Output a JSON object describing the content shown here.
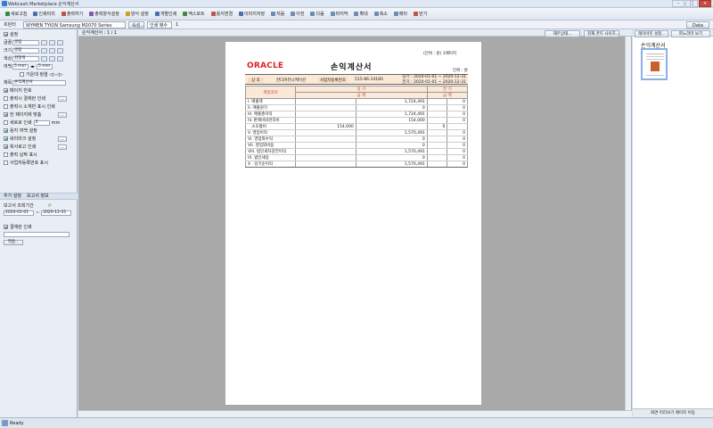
{
  "window": {
    "title": "Webcash Marketplace 손익계산서"
  },
  "menu": [
    {
      "label": "새로고침",
      "color": "#3a8e3a"
    },
    {
      "label": "인쇄미리",
      "color": "#4b6fb0"
    },
    {
      "label": "출력하기",
      "color": "#c0534a"
    },
    {
      "label": "출력양식설정",
      "color": "#7e5ab0"
    },
    {
      "label": "양식 설정",
      "color": "#d49a2a"
    },
    {
      "label": "개별인쇄",
      "color": "#4b6fb0"
    },
    {
      "label": "엑스포트",
      "color": "#3a8e3a"
    },
    {
      "label": "용지변경",
      "color": "#c0534a"
    },
    {
      "label": "이미지저장",
      "color": "#4b6fb0"
    },
    {
      "label": "처음",
      "color": "#6b8bb8"
    },
    {
      "label": "이전",
      "color": "#6b8bb8"
    },
    {
      "label": "다음",
      "color": "#6b8bb8"
    },
    {
      "label": "마지막",
      "color": "#6b8bb8"
    },
    {
      "label": "확대",
      "color": "#6b8bb8"
    },
    {
      "label": "축소",
      "color": "#6b8bb8"
    },
    {
      "label": "메타",
      "color": "#6b8bb8"
    },
    {
      "label": "닫기",
      "color": "#c0534a"
    }
  ],
  "toolbar": {
    "printer_label": "프린터",
    "printer_value": "WYMEN TYION Samsung M2070 Series",
    "btn_prop": "속성...",
    "print_options": "인쇄 매수",
    "copies": "1",
    "right_btn": "Data"
  },
  "left": {
    "section": "설정",
    "font_rows": [
      {
        "label": "글꼴",
        "value": "굴림"
      },
      {
        "label": "크기",
        "value": "굴림"
      },
      {
        "label": "색상",
        "value": "검정색"
      }
    ],
    "margin_label": "여백",
    "margin_value": "5 mm",
    "margin_value2": "5 mm",
    "align_label": "가운데 정렬 ◁▷◁▷",
    "title_label": "제목",
    "title_value": "손익계산서",
    "options": [
      {
        "label": "페이지 번호",
        "extra": "쪽 번호 표시",
        "on": true
      },
      {
        "label": "출력시 결재란 인쇄",
        "on": false
      },
      {
        "label": "출력시 소계만 표시 인쇄",
        "on": false
      },
      {
        "label": "한 페이지에 맞춤",
        "on": true
      },
      {
        "label": "세로로 인쇄",
        "on": false
      },
      {
        "label": "용지 여백 설정",
        "on": true
      },
      {
        "label": "워터마크 설정",
        "on": true
      },
      {
        "label": "회사로고 인쇄",
        "on": true
      },
      {
        "label": "출력 날짜 표시",
        "on": false
      },
      {
        "label": "사업자등록번호 표시",
        "on": false
      }
    ],
    "mm_value": "5",
    "mm_unit": "mm",
    "tab1": "추가 설정",
    "tab2": "보고서 정보",
    "period_label": "보고서 조회기간",
    "date_from": "2020-01-01",
    "date_to": "2020-12-31",
    "approve_label": "결재란 인쇄",
    "approve_btn": "적용..."
  },
  "pagebar": {
    "label": "손익계산서 : 1 / 1"
  },
  "report": {
    "top_right": "(단위 : 원) 1페이지",
    "logo": "ORACLE",
    "title": "손익계산서",
    "unit": "단위 : 원",
    "company_label": "상 호",
    "company": "한다커뮤니케이션",
    "bizno_label": "사업자등록번호",
    "bizno": "515-86-14180",
    "period1": "당기 : 2020-01-01 ~ 2020-12-31",
    "period2": "전기 : 2020-01-01 ~ 2020-12-31",
    "col_account": "계정과목",
    "col_cur": "당 기",
    "col_prev": "전 기",
    "col_amount": "금 액",
    "rows": [
      {
        "name": "I. 매출액",
        "a": "",
        "b": "1,724,491",
        "c": "",
        "d": "0"
      },
      {
        "name": "II. 매출원가",
        "a": "",
        "b": "0",
        "c": "",
        "d": "0"
      },
      {
        "name": "III. 매출총이익",
        "a": "",
        "b": "1,724,491",
        "c": "",
        "d": "0"
      },
      {
        "name": "IV. 판매비와관리비",
        "a": "",
        "b": "154,000",
        "c": "",
        "d": "0"
      },
      {
        "name": "   소모품비",
        "a": "154,000",
        "b": "",
        "c": "0",
        "d": ""
      },
      {
        "name": "V. 영업이익",
        "a": "",
        "b": "1,570,491",
        "c": "",
        "d": "0"
      },
      {
        "name": "VI. 영업외수익",
        "a": "",
        "b": "0",
        "c": "",
        "d": "0"
      },
      {
        "name": "VII. 영업외비용",
        "a": "",
        "b": "0",
        "c": "",
        "d": "0"
      },
      {
        "name": "VIII. 법인세차감전이익",
        "a": "",
        "b": "1,570,491",
        "c": "",
        "d": "0"
      },
      {
        "name": "IX. 법인세등",
        "a": "",
        "b": "0",
        "c": "",
        "d": "0"
      },
      {
        "name": "X . 당기순이익",
        "a": "",
        "b": "1,570,491",
        "c": "",
        "d": "0"
      }
    ]
  },
  "right": {
    "btn1": "재무상태...",
    "btn2": "현재 폰트 사이즈...",
    "btn3": "레이아웃 설정...",
    "btn4": "파노라마 보기",
    "title": "손익계산서",
    "bottom": "화면 미리보기 페이지 이동"
  },
  "status": {
    "text": "Ready"
  }
}
